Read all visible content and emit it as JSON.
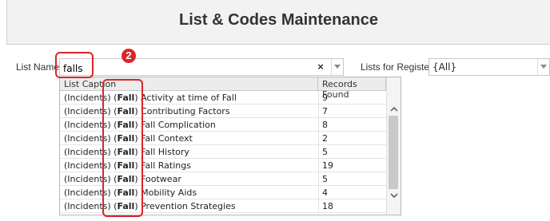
{
  "header": {
    "title": "List & Codes Maintenance"
  },
  "form": {
    "list_name_label": "List Name:",
    "list_name_value": "falls",
    "clear_glyph": "×",
    "register_label": "Lists for Register:",
    "register_value": "{All}"
  },
  "dropdown": {
    "columns": {
      "caption": "List Caption",
      "records": "Records Found"
    },
    "rows": [
      {
        "prefix": "(Incidents) (",
        "match": "Fall",
        "rest": ") Activity at time of Fall",
        "count": "9"
      },
      {
        "prefix": "(Incidents) (",
        "match": "Fall",
        "rest": ") Contributing Factors",
        "count": "7"
      },
      {
        "prefix": "(Incidents) (",
        "match": "Fall",
        "rest": ") Fall Complication",
        "count": "8"
      },
      {
        "prefix": "(Incidents) (",
        "match": "Fall",
        "rest": ") Fall Context",
        "count": "2"
      },
      {
        "prefix": "(Incidents) (",
        "match": "Fall",
        "rest": ") Fall History",
        "count": "5"
      },
      {
        "prefix": "(Incidents) (",
        "match": "Fall",
        "rest": ") Fall Ratings",
        "count": "19"
      },
      {
        "prefix": "(Incidents) (",
        "match": "Fall",
        "rest": ") Footwear",
        "count": "5"
      },
      {
        "prefix": "(Incidents) (",
        "match": "Fall",
        "rest": ") Mobility Aids",
        "count": "4"
      },
      {
        "prefix": "(Incidents) (",
        "match": "Fall",
        "rest": ") Prevention Strategies",
        "count": "18"
      }
    ]
  },
  "annotation": {
    "badge_number": "2"
  },
  "colors": {
    "callout": "#d9262b",
    "header_bg": "#f2f2f2",
    "scrollbar_thumb": "#c9c9c9"
  },
  "icons": {
    "scroll_up": "chevron-up-icon",
    "scroll_down": "chevron-down-icon",
    "dropdown_arrow": "triangle-down-icon"
  }
}
